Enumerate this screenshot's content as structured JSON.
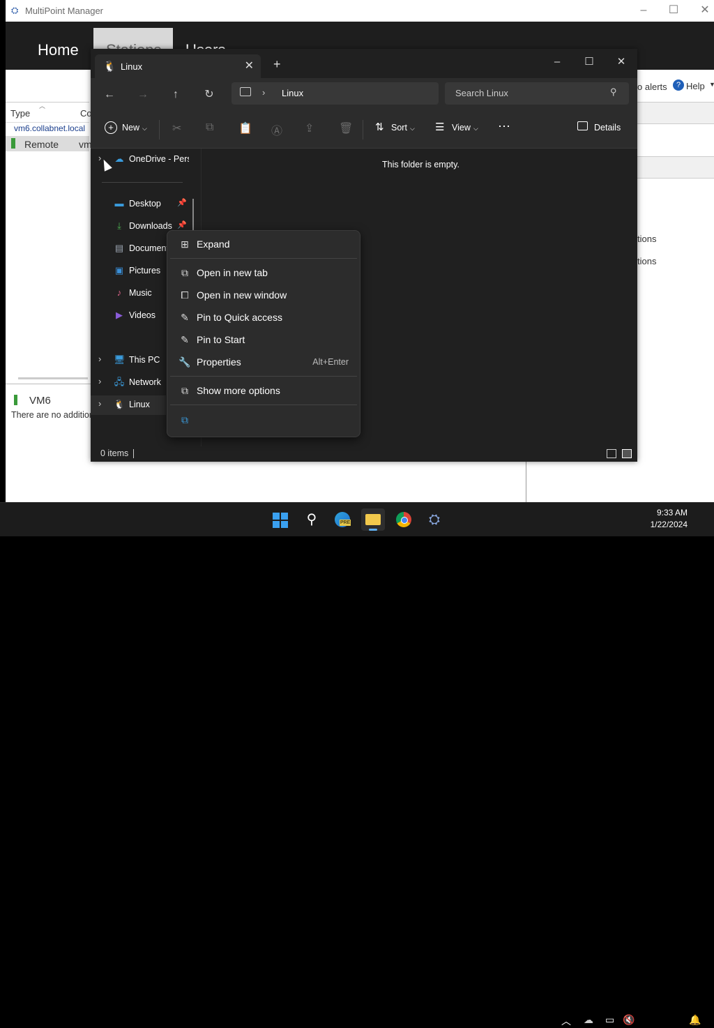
{
  "mpm": {
    "title": "MultiPoint Manager",
    "tabs": [
      "Home",
      "Stations",
      "Users"
    ],
    "alerts_text": "o alerts",
    "help_label": "Help",
    "col_type": "Type",
    "col_co": "Co",
    "row_host": "vm6.collabnet.local",
    "row_remote": "Remote",
    "row_remote_vm": "vm",
    "right_text1": "tions",
    "right_text2": "tions",
    "vm_title": "VM6",
    "vm_desc": "There are no addition"
  },
  "explorer": {
    "tab_label": "Linux",
    "address_path": "Linux",
    "search_placeholder": "Search Linux",
    "toolbar": {
      "new_label": "New",
      "sort_label": "Sort",
      "view_label": "View",
      "details_label": "Details"
    },
    "nav": {
      "onedrive": "OneDrive - Pers",
      "quick": [
        {
          "label": "Desktop",
          "icon": "desktop-icon",
          "color": "#3a9bdc"
        },
        {
          "label": "Downloads",
          "icon": "downloads-icon",
          "color": "#4caf50"
        },
        {
          "label": "Documents",
          "icon": "documents-icon",
          "color": "#9aa4b0"
        },
        {
          "label": "Pictures",
          "icon": "pictures-icon",
          "color": "#3a8fd8"
        },
        {
          "label": "Music",
          "icon": "music-icon",
          "color": "#e0648a"
        },
        {
          "label": "Videos",
          "icon": "videos-icon",
          "color": "#8a5cd8"
        }
      ],
      "this_pc": "This PC",
      "network": "Network",
      "linux": "Linux"
    },
    "empty_message": "This folder is empty.",
    "status_items": "0 items"
  },
  "context_menu": {
    "items": [
      {
        "label": "Expand",
        "shortcut": ""
      },
      {
        "label": "Open in new tab",
        "shortcut": ""
      },
      {
        "label": "Open in new window",
        "shortcut": ""
      },
      {
        "label": "Pin to Quick access",
        "shortcut": ""
      },
      {
        "label": "Pin to Start",
        "shortcut": ""
      },
      {
        "label": "Properties",
        "shortcut": "Alt+Enter"
      },
      {
        "label": "Show more options",
        "shortcut": ""
      }
    ]
  },
  "taskbar": {
    "time": "9:33 AM",
    "date": "1/22/2024",
    "edge_badge": "PRE"
  },
  "colors": {
    "explorer_bg": "#202020",
    "menu_bg": "#2c2c2c",
    "accent_blue": "#3a9bdc"
  }
}
